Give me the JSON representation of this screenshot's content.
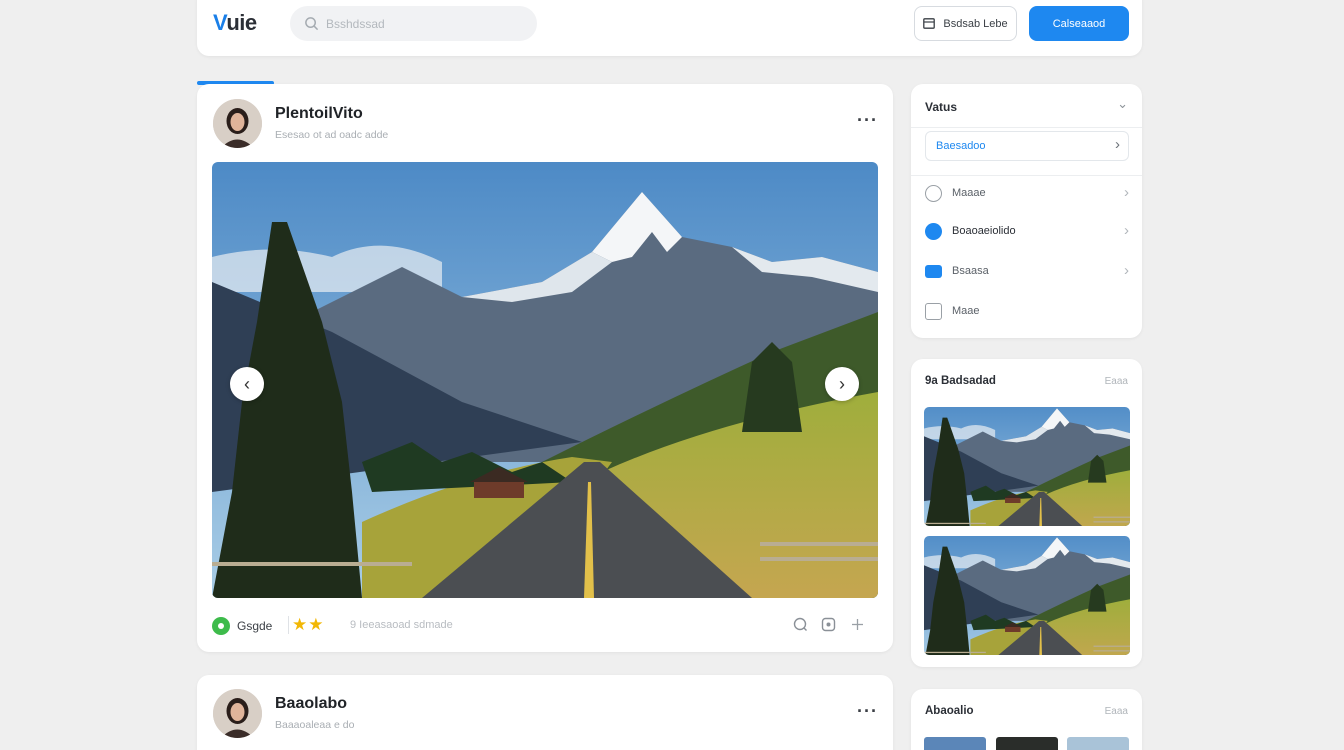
{
  "header": {
    "logo_first": "V",
    "logo_rest": "uie",
    "search_placeholder": "Bsshdssad",
    "outline_button": "Bsdsab Lebe",
    "primary_button": "Calseaaod"
  },
  "post1": {
    "name": "PlentoilVito",
    "subtitle": "Esesao ot ad oadc adde",
    "more": "···",
    "prev": "‹",
    "next": "›",
    "footer_label": "Gsgde",
    "stars": "★★",
    "footer_meta": "9 Ieeasaoad sdmade"
  },
  "post2": {
    "name": "Baaolabo",
    "subtitle": "Baaaoaleaa e do",
    "more": "···"
  },
  "menu": {
    "title": "Vatus",
    "active_item": "Baesadoo",
    "items": [
      {
        "label": "Maaae",
        "icon": "clock-icon",
        "color": "#9aa0a6"
      },
      {
        "label": "Boaoaeiolido",
        "icon": "chat-icon",
        "color": "#1e88f0"
      },
      {
        "label": "Bsaasa",
        "icon": "card-icon",
        "color": "#1e88f0"
      },
      {
        "label": "Maae",
        "icon": "square-icon",
        "color": "#9aa0a6"
      }
    ]
  },
  "gallery": {
    "title": "9a Badsadad",
    "link": "Eaaa"
  },
  "gallery2": {
    "title": "Abaoalio",
    "link": "Eaaa"
  },
  "progress_percent": 11,
  "colors": {
    "accent": "#1e88f0",
    "online": "#3dbb4b",
    "star": "#f2b705"
  }
}
